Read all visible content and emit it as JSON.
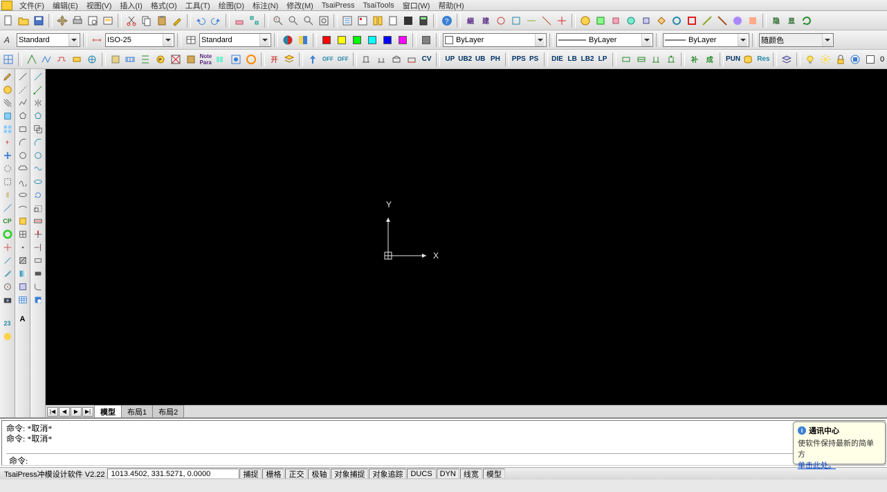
{
  "menu": {
    "items": [
      "文件(F)",
      "编辑(E)",
      "视图(V)",
      "插入(I)",
      "格式(O)",
      "工具(T)",
      "绘图(D)",
      "标注(N)",
      "修改(M)",
      "TsaiPress",
      "TsaiTools",
      "窗口(W)",
      "帮助(H)"
    ]
  },
  "toolbar2": {
    "text_style": "Standard",
    "dim_style": "ISO-25",
    "table_style": "Standard",
    "layer": "ByLayer",
    "linetype": "ByLayer",
    "lineweight": "ByLayer",
    "color_combo": "随颜色"
  },
  "toolbar3": {
    "labels": [
      "CV",
      "UP",
      "UB2",
      "UB",
      "PH",
      "PPS",
      "PS",
      "DIE",
      "LB",
      "LB2",
      "LP",
      "PUN",
      "Res"
    ],
    "cn_labels": [
      "补",
      "成"
    ],
    "layer_count": "0"
  },
  "toolbar_icons_row1_cn": [
    "綑",
    "建",
    "隐",
    "显"
  ],
  "tabs": {
    "nav": [
      "|◀",
      "◀",
      "▶",
      "▶|"
    ],
    "model": "模型",
    "layout1": "布局1",
    "layout2": "布局2"
  },
  "ucs": {
    "x": "X",
    "y": "Y"
  },
  "command": {
    "line1": "命令:  *取消*",
    "line2": "命令:  *取消*",
    "prompt": "命令:"
  },
  "balloon": {
    "title": "通讯中心",
    "text": "使软件保持最新的简单方",
    "link": "单击此处。"
  },
  "status": {
    "app": "TsaiPress冲模设计软件 V2.22",
    "coords": "1013.4502, 331.5271, 0.0000",
    "buttons": [
      "捕捉",
      "栅格",
      "正交",
      "极轴",
      "对象捕捉",
      "对象追踪",
      "DUCS",
      "DYN",
      "线宽",
      "模型"
    ]
  }
}
